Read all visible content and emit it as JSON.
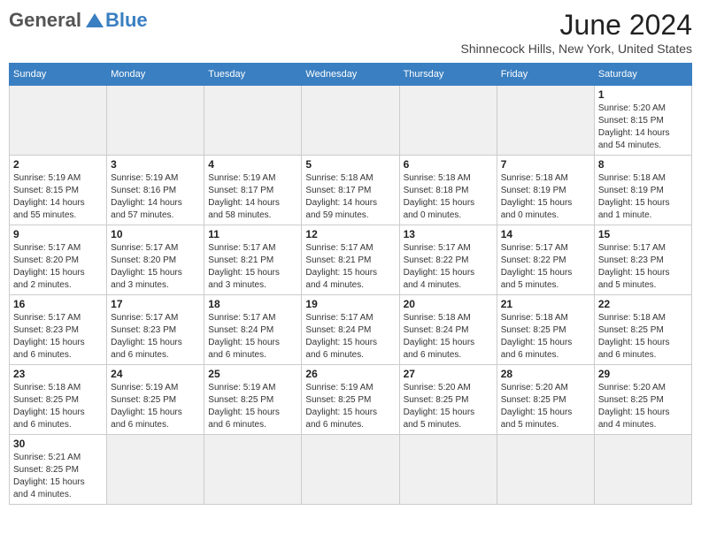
{
  "header": {
    "logo_line1": "General",
    "logo_line2": "Blue",
    "title": "June 2024",
    "location": "Shinnecock Hills, New York, United States"
  },
  "days_of_week": [
    "Sunday",
    "Monday",
    "Tuesday",
    "Wednesday",
    "Thursday",
    "Friday",
    "Saturday"
  ],
  "weeks": [
    [
      {
        "day": "",
        "info": ""
      },
      {
        "day": "",
        "info": ""
      },
      {
        "day": "",
        "info": ""
      },
      {
        "day": "",
        "info": ""
      },
      {
        "day": "",
        "info": ""
      },
      {
        "day": "",
        "info": ""
      },
      {
        "day": "1",
        "info": "Sunrise: 5:20 AM\nSunset: 8:15 PM\nDaylight: 14 hours\nand 54 minutes."
      }
    ],
    [
      {
        "day": "2",
        "info": "Sunrise: 5:19 AM\nSunset: 8:15 PM\nDaylight: 14 hours\nand 55 minutes."
      },
      {
        "day": "3",
        "info": "Sunrise: 5:19 AM\nSunset: 8:16 PM\nDaylight: 14 hours\nand 57 minutes."
      },
      {
        "day": "4",
        "info": "Sunrise: 5:19 AM\nSunset: 8:17 PM\nDaylight: 14 hours\nand 58 minutes."
      },
      {
        "day": "5",
        "info": "Sunrise: 5:18 AM\nSunset: 8:17 PM\nDaylight: 14 hours\nand 59 minutes."
      },
      {
        "day": "6",
        "info": "Sunrise: 5:18 AM\nSunset: 8:18 PM\nDaylight: 15 hours\nand 0 minutes."
      },
      {
        "day": "7",
        "info": "Sunrise: 5:18 AM\nSunset: 8:19 PM\nDaylight: 15 hours\nand 0 minutes."
      },
      {
        "day": "8",
        "info": "Sunrise: 5:18 AM\nSunset: 8:19 PM\nDaylight: 15 hours\nand 1 minute."
      }
    ],
    [
      {
        "day": "9",
        "info": "Sunrise: 5:17 AM\nSunset: 8:20 PM\nDaylight: 15 hours\nand 2 minutes."
      },
      {
        "day": "10",
        "info": "Sunrise: 5:17 AM\nSunset: 8:20 PM\nDaylight: 15 hours\nand 3 minutes."
      },
      {
        "day": "11",
        "info": "Sunrise: 5:17 AM\nSunset: 8:21 PM\nDaylight: 15 hours\nand 3 minutes."
      },
      {
        "day": "12",
        "info": "Sunrise: 5:17 AM\nSunset: 8:21 PM\nDaylight: 15 hours\nand 4 minutes."
      },
      {
        "day": "13",
        "info": "Sunrise: 5:17 AM\nSunset: 8:22 PM\nDaylight: 15 hours\nand 4 minutes."
      },
      {
        "day": "14",
        "info": "Sunrise: 5:17 AM\nSunset: 8:22 PM\nDaylight: 15 hours\nand 5 minutes."
      },
      {
        "day": "15",
        "info": "Sunrise: 5:17 AM\nSunset: 8:23 PM\nDaylight: 15 hours\nand 5 minutes."
      }
    ],
    [
      {
        "day": "16",
        "info": "Sunrise: 5:17 AM\nSunset: 8:23 PM\nDaylight: 15 hours\nand 6 minutes."
      },
      {
        "day": "17",
        "info": "Sunrise: 5:17 AM\nSunset: 8:23 PM\nDaylight: 15 hours\nand 6 minutes."
      },
      {
        "day": "18",
        "info": "Sunrise: 5:17 AM\nSunset: 8:24 PM\nDaylight: 15 hours\nand 6 minutes."
      },
      {
        "day": "19",
        "info": "Sunrise: 5:17 AM\nSunset: 8:24 PM\nDaylight: 15 hours\nand 6 minutes."
      },
      {
        "day": "20",
        "info": "Sunrise: 5:18 AM\nSunset: 8:24 PM\nDaylight: 15 hours\nand 6 minutes."
      },
      {
        "day": "21",
        "info": "Sunrise: 5:18 AM\nSunset: 8:25 PM\nDaylight: 15 hours\nand 6 minutes."
      },
      {
        "day": "22",
        "info": "Sunrise: 5:18 AM\nSunset: 8:25 PM\nDaylight: 15 hours\nand 6 minutes."
      }
    ],
    [
      {
        "day": "23",
        "info": "Sunrise: 5:18 AM\nSunset: 8:25 PM\nDaylight: 15 hours\nand 6 minutes."
      },
      {
        "day": "24",
        "info": "Sunrise: 5:19 AM\nSunset: 8:25 PM\nDaylight: 15 hours\nand 6 minutes."
      },
      {
        "day": "25",
        "info": "Sunrise: 5:19 AM\nSunset: 8:25 PM\nDaylight: 15 hours\nand 6 minutes."
      },
      {
        "day": "26",
        "info": "Sunrise: 5:19 AM\nSunset: 8:25 PM\nDaylight: 15 hours\nand 6 minutes."
      },
      {
        "day": "27",
        "info": "Sunrise: 5:20 AM\nSunset: 8:25 PM\nDaylight: 15 hours\nand 5 minutes."
      },
      {
        "day": "28",
        "info": "Sunrise: 5:20 AM\nSunset: 8:25 PM\nDaylight: 15 hours\nand 5 minutes."
      },
      {
        "day": "29",
        "info": "Sunrise: 5:20 AM\nSunset: 8:25 PM\nDaylight: 15 hours\nand 4 minutes."
      }
    ],
    [
      {
        "day": "30",
        "info": "Sunrise: 5:21 AM\nSunset: 8:25 PM\nDaylight: 15 hours\nand 4 minutes."
      },
      {
        "day": "",
        "info": ""
      },
      {
        "day": "",
        "info": ""
      },
      {
        "day": "",
        "info": ""
      },
      {
        "day": "",
        "info": ""
      },
      {
        "day": "",
        "info": ""
      },
      {
        "day": "",
        "info": ""
      }
    ]
  ]
}
